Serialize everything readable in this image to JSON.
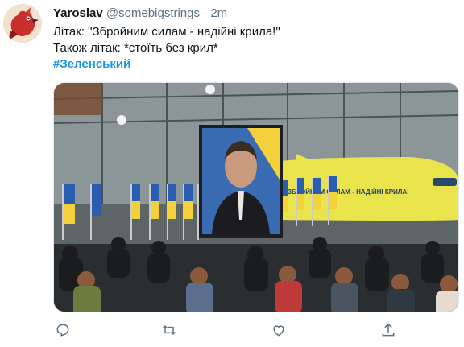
{
  "tweet": {
    "display_name": "Yaroslav",
    "handle": "@somebigstrings",
    "separator": "·",
    "time": "2m",
    "lines": [
      "Літак: \"Збройним силам - надійні крила!\"",
      "Також літак: *стоїть без крил*"
    ],
    "hashtag": "#Зеленський"
  },
  "media": {
    "plane_banner_text": "ЗБРОЙНИМ СИЛАМ - НАДІЙНІ КРИЛА!"
  },
  "actions": {
    "reply": "reply-icon",
    "retweet": "retweet-icon",
    "like": "heart-icon",
    "share": "share-icon"
  },
  "colors": {
    "hashtag": "#1b95e0",
    "meta": "#5b7083",
    "plane": "#e9e44b"
  }
}
